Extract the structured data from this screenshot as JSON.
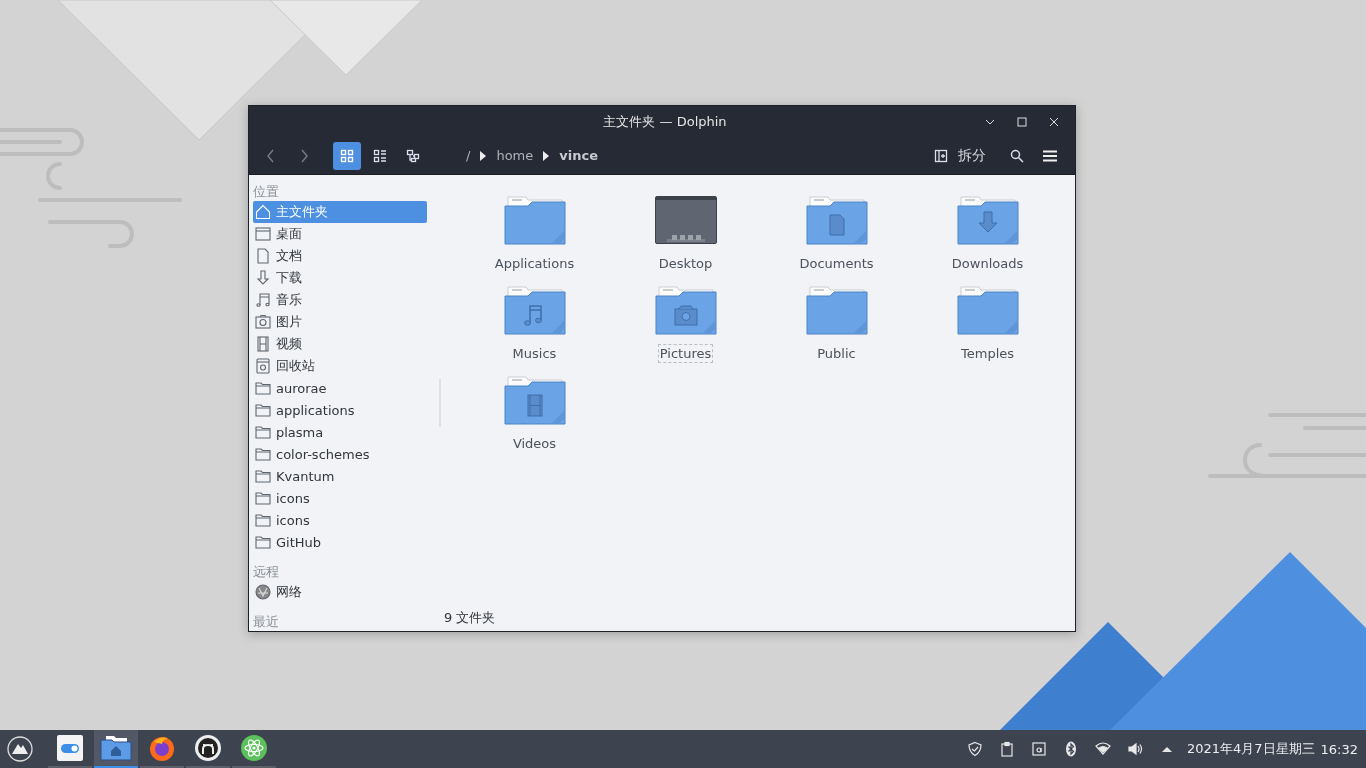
{
  "window": {
    "title": "主文件夹 — Dolphin"
  },
  "toolbar": {
    "view_modes": [
      {
        "kind": "icons",
        "selected": true
      },
      {
        "kind": "details",
        "selected": false
      },
      {
        "kind": "tree",
        "selected": false
      }
    ],
    "breadcrumb": [
      "/",
      "home",
      "vince"
    ],
    "split_label": "拆分"
  },
  "sidebar": {
    "sections": [
      {
        "heading": "位置",
        "items": [
          {
            "label": "主文件夹",
            "kind": "home",
            "selected": true
          },
          {
            "label": "桌面",
            "kind": "desktop",
            "selected": false
          },
          {
            "label": "文档",
            "kind": "document",
            "selected": false
          },
          {
            "label": "下载",
            "kind": "download",
            "selected": false
          },
          {
            "label": "音乐",
            "kind": "music",
            "selected": false
          },
          {
            "label": "图片",
            "kind": "picture",
            "selected": false
          },
          {
            "label": "视频",
            "kind": "video",
            "selected": false
          },
          {
            "label": "回收站",
            "kind": "trash",
            "selected": false
          },
          {
            "label": "aurorae",
            "kind": "folder",
            "selected": false
          },
          {
            "label": "applications",
            "kind": "folder",
            "selected": false
          },
          {
            "label": "plasma",
            "kind": "folder",
            "selected": false
          },
          {
            "label": "color-schemes",
            "kind": "folder",
            "selected": false
          },
          {
            "label": "Kvantum",
            "kind": "folder",
            "selected": false
          },
          {
            "label": "icons",
            "kind": "folder",
            "selected": false
          },
          {
            "label": "icons",
            "kind": "folder",
            "selected": false
          },
          {
            "label": "GitHub",
            "kind": "folder",
            "selected": false
          }
        ]
      },
      {
        "heading": "远程",
        "items": [
          {
            "label": "网络",
            "kind": "network",
            "selected": false
          }
        ]
      },
      {
        "heading": "最近"
      }
    ]
  },
  "files": [
    {
      "name": "Applications",
      "kind": "folder",
      "focused": false
    },
    {
      "name": "Desktop",
      "kind": "screen",
      "focused": false
    },
    {
      "name": "Documents",
      "kind": "documents",
      "focused": false
    },
    {
      "name": "Downloads",
      "kind": "downloads",
      "focused": false
    },
    {
      "name": "Musics",
      "kind": "music",
      "focused": false
    },
    {
      "name": "Pictures",
      "kind": "pictures",
      "focused": true
    },
    {
      "name": "Public",
      "kind": "folder",
      "focused": false
    },
    {
      "name": "Temples",
      "kind": "folder",
      "focused": false
    },
    {
      "name": "Videos",
      "kind": "videos",
      "focused": false
    }
  ],
  "status_bar": "9 文件夹",
  "taskbar": {
    "apps": [
      {
        "kind": "settings",
        "selected": false
      },
      {
        "kind": "files",
        "selected": true
      },
      {
        "kind": "browser",
        "selected": false
      },
      {
        "kind": "github",
        "selected": false
      },
      {
        "kind": "atom",
        "selected": false
      }
    ],
    "date": "2021年4月7日星期三",
    "time": "16:32"
  }
}
